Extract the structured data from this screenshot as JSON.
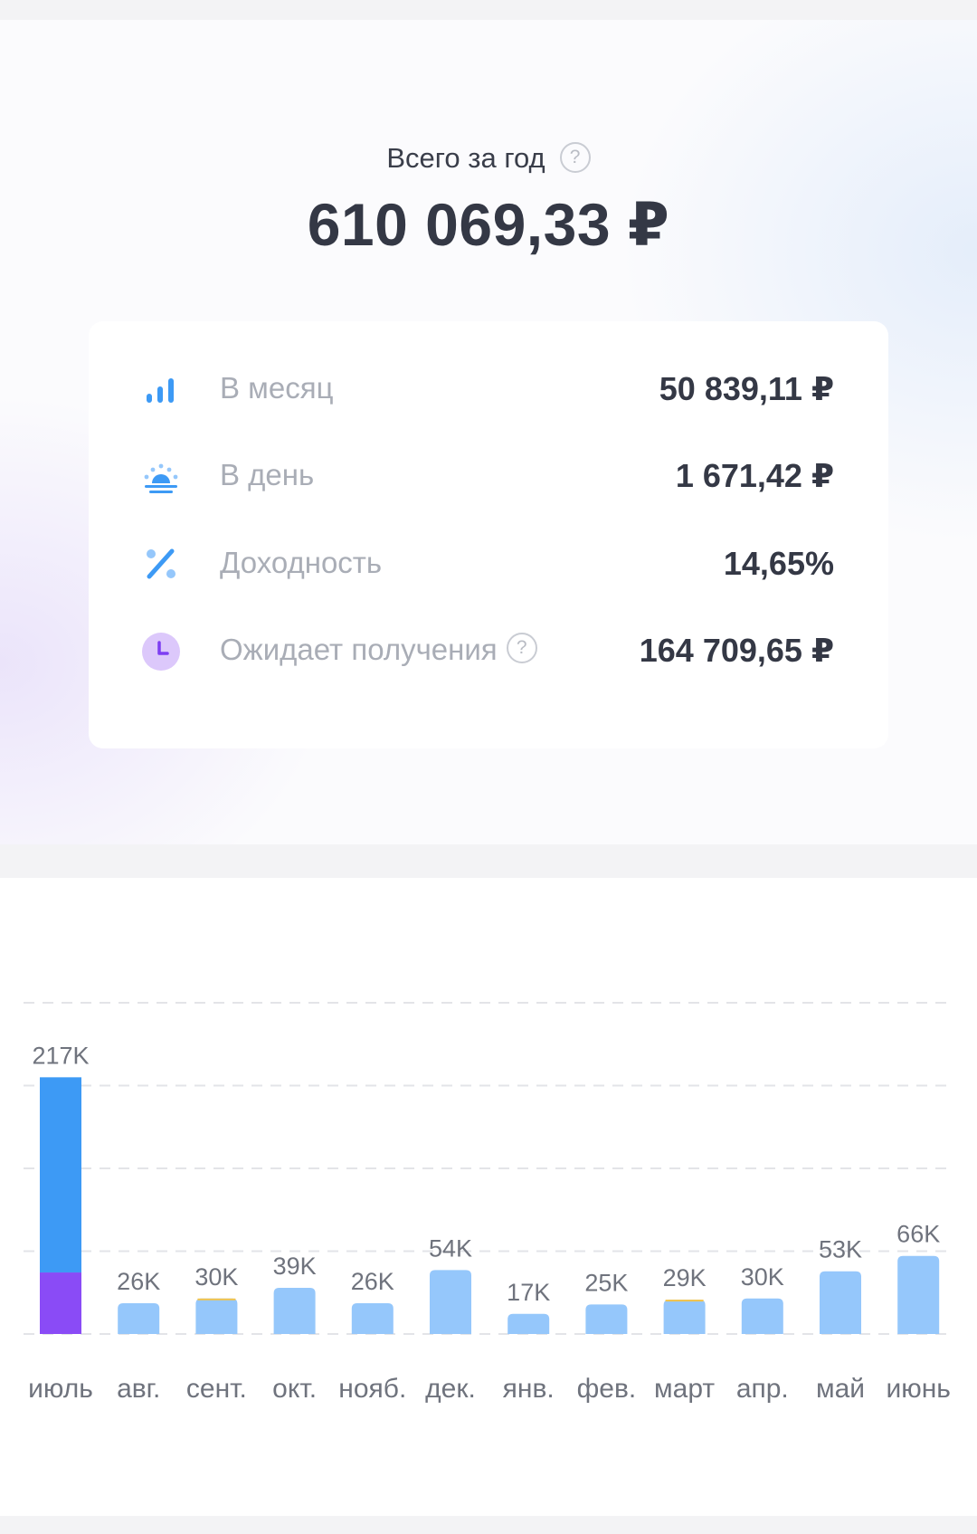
{
  "summary": {
    "title": "Всего за год",
    "help_glyph": "?",
    "total": "610 069,33 ₽"
  },
  "stats": [
    {
      "label": "В месяц",
      "value": "50 839,11 ₽",
      "icon": "bar-signal-icon"
    },
    {
      "label": "В день",
      "value": "1 671,42 ₽",
      "icon": "sunrise-icon"
    },
    {
      "label": "Доходность",
      "value": "14,65%",
      "icon": "percent-icon"
    },
    {
      "label": "Ожидает получения",
      "value": "164 709,65 ₽",
      "icon": "clock-icon",
      "help_glyph": "?"
    }
  ],
  "colors": {
    "accent_blue": "#3d9af5",
    "light_blue": "#95c7fb",
    "purple": "#8a4bf6",
    "yellow_accent": "#f3c34a",
    "text_dark": "#343845",
    "text_muted": "#a9adb6"
  },
  "chart_data": {
    "type": "bar",
    "categories": [
      "июль",
      "авг.",
      "сент.",
      "окт.",
      "нояб.",
      "дек.",
      "янв.",
      "фев.",
      "март",
      "апр.",
      "май",
      "июнь"
    ],
    "values": [
      217,
      26,
      30,
      39,
      26,
      54,
      17,
      25,
      29,
      30,
      53,
      66
    ],
    "value_labels": [
      "217K",
      "26K",
      "30K",
      "39K",
      "26K",
      "54K",
      "17K",
      "25K",
      "29K",
      "30K",
      "53K",
      "66K"
    ],
    "stack_first": {
      "lower": 52,
      "upper": 165
    },
    "ylim": [
      0,
      280
    ],
    "grid": "dashed horizontal"
  }
}
